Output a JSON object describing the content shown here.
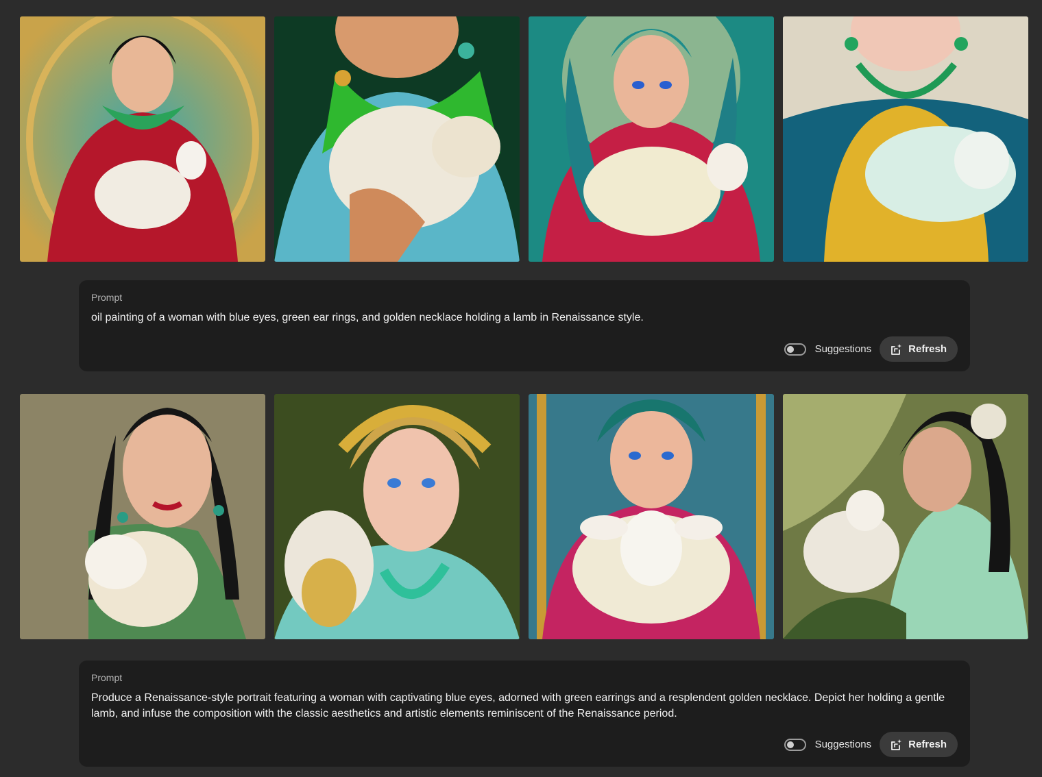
{
  "colors": {
    "page_bg": "#2c2c2c",
    "panel_bg": "#1d1d1d",
    "button_bg": "#3b3b3b",
    "text_primary": "#f2f2f2",
    "text_secondary": "#b4b4b4"
  },
  "sections": [
    {
      "prompt_label": "Prompt",
      "prompt_text": "oil painting of a woman with blue eyes, green ear rings, and golden necklace holding a lamb in Renaissance style.",
      "suggestions_label": "Suggestions",
      "suggestions_on": false,
      "refresh_label": "Refresh",
      "refresh_icon": "refresh-sparkle-icon"
    },
    {
      "prompt_label": "Prompt",
      "prompt_text": "Produce a Renaissance-style portrait featuring a woman with captivating blue eyes, adorned with green earrings and a resplendent golden necklace. Depict her holding a gentle lamb, and infuse the composition with the classic aesthetics and artistic elements reminiscent of the Renaissance period.",
      "suggestions_label": "Suggestions",
      "suggestions_on": false,
      "refresh_label": "Refresh",
      "refresh_icon": "refresh-sparkle-icon"
    }
  ]
}
